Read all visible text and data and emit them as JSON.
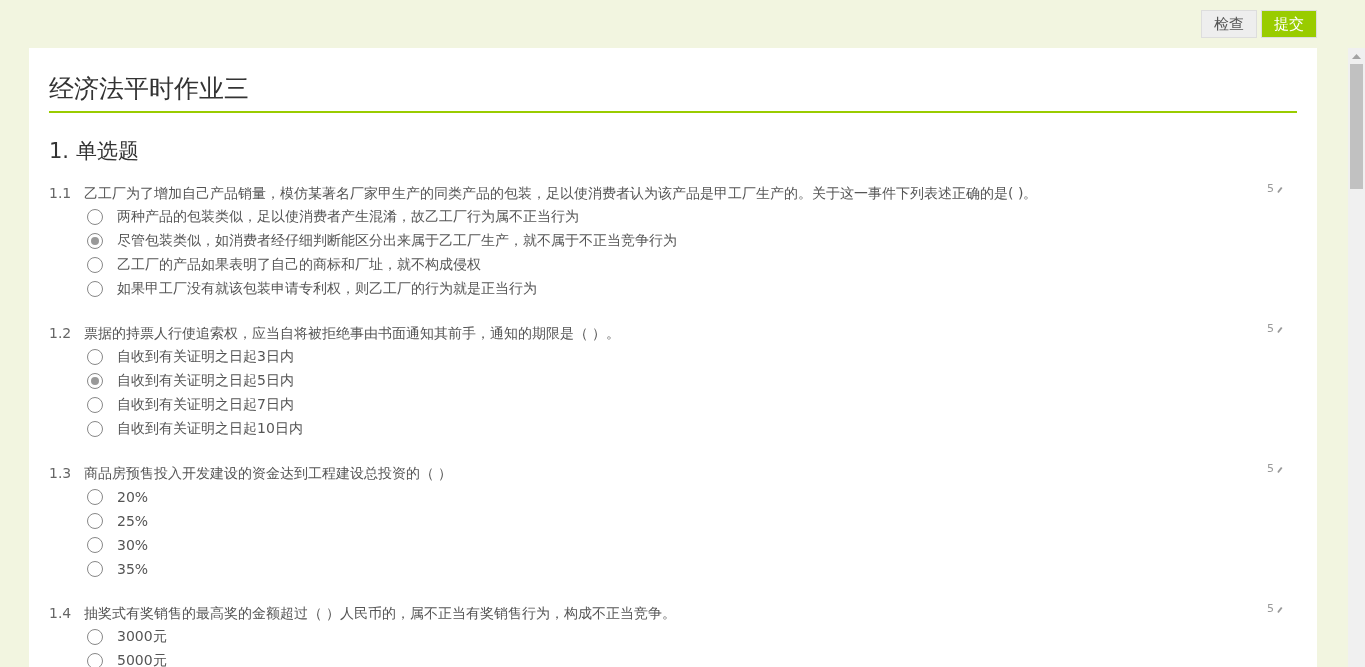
{
  "toolbar": {
    "buttons": [
      {
        "label": "检查",
        "kind": "plain"
      },
      {
        "label": "提交",
        "kind": "primary"
      }
    ]
  },
  "title": "经济法平时作业三",
  "sections": [
    {
      "heading": "1. 单选题",
      "questions": [
        {
          "number": "1.1",
          "text": "乙工厂为了增加自己产品销量，模仿某著名厂家甲生产的同类产品的包装，足以使消费者认为该产品是甲工厂生产的。关于这一事件下列表述正确的是( )。",
          "score": "5",
          "options": [
            {
              "label": "两种产品的包装类似，足以使消费者产生混淆，故乙工厂行为属不正当行为",
              "selected": false
            },
            {
              "label": "尽管包装类似，如消费者经仔细判断能区分出来属于乙工厂生产，就不属于不正当竞争行为",
              "selected": true
            },
            {
              "label": "乙工厂的产品如果表明了自己的商标和厂址，就不构成侵权",
              "selected": false
            },
            {
              "label": "如果甲工厂没有就该包装申请专利权，则乙工厂的行为就是正当行为",
              "selected": false
            }
          ]
        },
        {
          "number": "1.2",
          "text": "票据的持票人行使追索权，应当自将被拒绝事由书面通知其前手，通知的期限是（ ）。",
          "score": "5",
          "options": [
            {
              "label": "自收到有关证明之日起3日内",
              "selected": false
            },
            {
              "label": "自收到有关证明之日起5日内",
              "selected": true
            },
            {
              "label": "自收到有关证明之日起7日内",
              "selected": false
            },
            {
              "label": "自收到有关证明之日起10日内",
              "selected": false
            }
          ]
        },
        {
          "number": "1.3",
          "text": "商品房预售投入开发建设的资金达到工程建设总投资的（ ）",
          "score": "5",
          "options": [
            {
              "label": "20%",
              "selected": false
            },
            {
              "label": "25%",
              "selected": false
            },
            {
              "label": "30%",
              "selected": false
            },
            {
              "label": "35%",
              "selected": false
            }
          ]
        },
        {
          "number": "1.4",
          "text": "抽奖式有奖销售的最高奖的金额超过（ ）人民币的，属不正当有奖销售行为，构成不正当竞争。",
          "score": "5",
          "options": [
            {
              "label": "3000元",
              "selected": false
            },
            {
              "label": "5000元",
              "selected": false
            }
          ]
        }
      ]
    }
  ]
}
